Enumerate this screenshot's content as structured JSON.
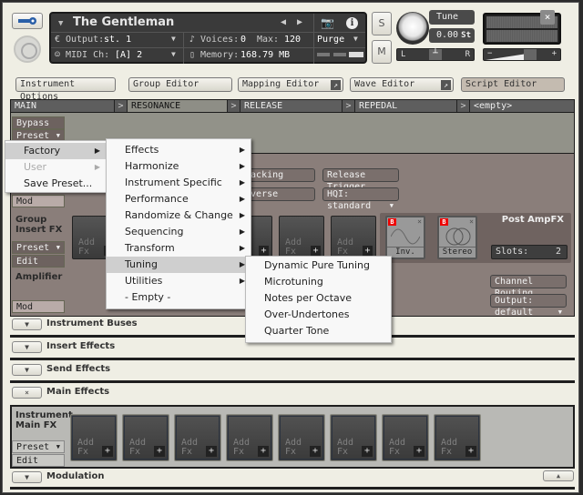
{
  "instrument": {
    "name": "The Gentleman",
    "output_label": "Output:",
    "output_value": "st. 1",
    "midi_label": "MIDI Ch:",
    "midi_value": "[A]  2",
    "voices_label": "Voices:",
    "voices_value": "0",
    "max_label": "Max:",
    "max_value": "120",
    "memory_label": "Memory:",
    "memory_value": "168.79 MB",
    "purge_label": "Purge",
    "solo_label": "S",
    "mute_label": "M",
    "tune_label": "Tune",
    "tune_value": "0.00",
    "tune_unit": "St",
    "pan_left": "L",
    "pan_right": "R",
    "vol_minus": "−",
    "vol_plus": "+",
    "close_label": "×"
  },
  "editor_buttons": [
    {
      "label": "Instrument Options"
    },
    {
      "label": "Group Editor"
    },
    {
      "label": "Mapping Editor",
      "popout": "↗"
    },
    {
      "label": "Wave Editor",
      "popout": "↗"
    },
    {
      "label": "Script Editor"
    }
  ],
  "script_tabs": [
    {
      "label": "MAIN",
      "active": false
    },
    {
      "label": "RESONANCE",
      "active": true
    },
    {
      "label": "RELEASE",
      "active": false
    },
    {
      "label": "REPEDAL",
      "active": false
    },
    {
      "label": "<empty>",
      "active": false
    }
  ],
  "tab_arrow": ">",
  "source": {
    "bypass_label": "Bypass",
    "preset_label": "Preset",
    "mod_label": "Mod",
    "tracking_label": "Tracking",
    "reverse_label": "Reverse",
    "release_trigger_label": "Release Trigger",
    "hqi_label": "HQI: standard"
  },
  "group_insert": {
    "title_line1": "Group",
    "title_line2": "Insert FX",
    "preset_label": "Preset",
    "edit_label": "Edit",
    "slot_text_line1": "Add",
    "slot_text_line2": "Fx",
    "slot_plus": "+"
  },
  "post_amp": {
    "title": "Post AmpFX",
    "slots_label": "Slots:",
    "slots_value": "2",
    "effects": [
      {
        "name": "Inv.",
        "badge": "B"
      },
      {
        "name": "Stereo",
        "badge": "B"
      }
    ]
  },
  "amplifier": {
    "title": "Amplifier",
    "mod_label": "Mod",
    "channel_routing_label": "Channel Routing",
    "output_label": "Output: default"
  },
  "sections": [
    {
      "label": "Instrument Buses",
      "toggle": "▼"
    },
    {
      "label": "Insert Effects",
      "toggle": "▼"
    },
    {
      "label": "Send Effects",
      "toggle": "▼"
    },
    {
      "label": "Main Effects",
      "toggle": "×"
    }
  ],
  "main_fx": {
    "title_line1": "Instrument",
    "title_line2": "Main FX",
    "preset_label": "Preset",
    "edit_label": "Edit",
    "slot_text_line1": "Add",
    "slot_text_line2": "Fx",
    "slot_plus": "+",
    "slot_count": 8
  },
  "modulation": {
    "label": "Modulation",
    "toggle": "▼",
    "collapse_icon": "▲"
  },
  "preset_menu": {
    "items": [
      {
        "label": "Factory",
        "submenu": true,
        "highlighted": true,
        "disabled": false
      },
      {
        "label": "User",
        "submenu": true,
        "highlighted": false,
        "disabled": true
      },
      {
        "label": "Save Preset...",
        "submenu": false,
        "highlighted": false,
        "disabled": false
      }
    ]
  },
  "factory_menu": {
    "items": [
      {
        "label": "Effects",
        "submenu": true,
        "highlighted": false
      },
      {
        "label": "Harmonize",
        "submenu": true,
        "highlighted": false
      },
      {
        "label": "Instrument Specific",
        "submenu": true,
        "highlighted": false
      },
      {
        "label": "Performance",
        "submenu": true,
        "highlighted": false
      },
      {
        "label": "Randomize & Change",
        "submenu": true,
        "highlighted": false
      },
      {
        "label": "Sequencing",
        "submenu": true,
        "highlighted": false
      },
      {
        "label": "Transform",
        "submenu": true,
        "highlighted": false
      },
      {
        "label": "Tuning",
        "submenu": true,
        "highlighted": true
      },
      {
        "label": "Utilities",
        "submenu": true,
        "highlighted": false
      },
      {
        "label": "- Empty -",
        "submenu": false,
        "highlighted": false
      }
    ]
  },
  "tuning_menu": {
    "items": [
      {
        "label": "Dynamic Pure Tuning"
      },
      {
        "label": "Microtuning"
      },
      {
        "label": "Notes per Octave"
      },
      {
        "label": "Over-Undertones"
      },
      {
        "label": "Quarter Tone"
      }
    ]
  }
}
